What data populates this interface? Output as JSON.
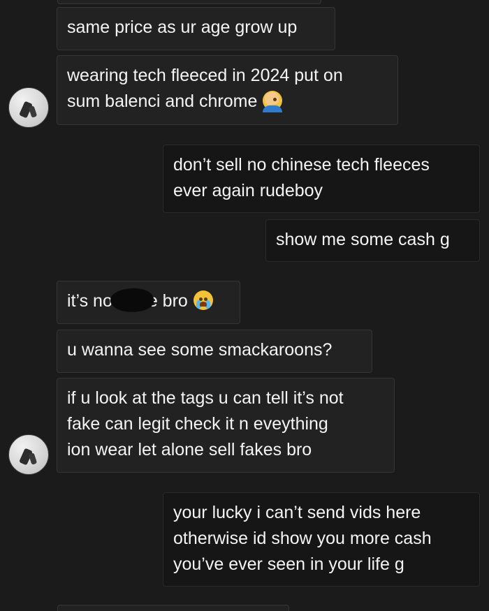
{
  "conversation": {
    "messages": [
      {
        "direction": "received",
        "lines": [
          "same price as ur age grow up"
        ]
      },
      {
        "direction": "received",
        "lines": [
          "wearing tech fleeced in 2024 put on",
          "sum balenci and chrome"
        ],
        "emoji": "face-palm-emoji"
      },
      {
        "direction": "sent",
        "lines": [
          "don’t sell no chinese tech fleeces",
          "ever again rudeboy"
        ]
      },
      {
        "direction": "sent",
        "lines": [
          "show me some cash g"
        ]
      },
      {
        "direction": "received",
        "lines": [
          "it’s not",
          "e bro"
        ],
        "emoji": "crying-face-emoji",
        "redacted": true
      },
      {
        "direction": "received",
        "lines": [
          "u wanna see some smackaroons?"
        ]
      },
      {
        "direction": "received",
        "lines": [
          "if u look at the tags u can tell it’s not",
          "fake can legit check it n eveything",
          "ion wear let alone sell fakes bro"
        ]
      },
      {
        "direction": "sent",
        "lines": [
          "your lucky i can’t send vids here",
          "otherwise id show you more cash",
          "you’ve ever seen in your life g"
        ]
      }
    ]
  },
  "colors": {
    "background": "#1b1b1b",
    "received_bubble": "#222222",
    "sent_bubble": "#161616",
    "text": "#f4f4f4"
  }
}
